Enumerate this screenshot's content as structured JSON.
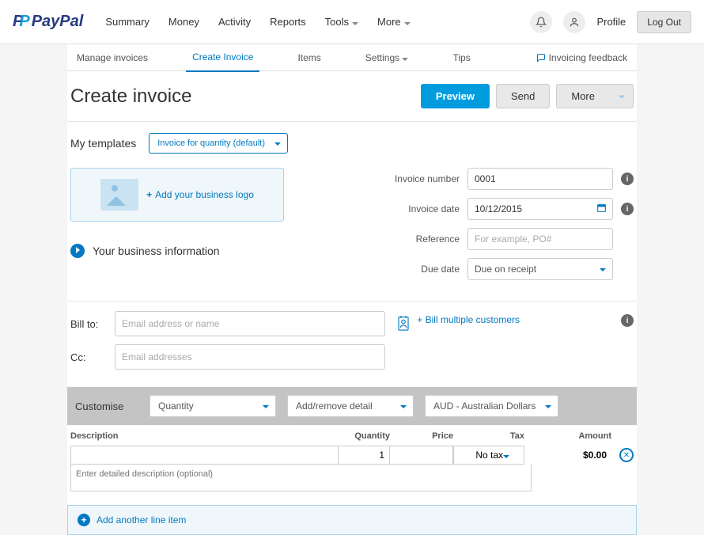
{
  "brand": "PayPal",
  "topnav": {
    "summary": "Summary",
    "money": "Money",
    "activity": "Activity",
    "reports": "Reports",
    "tools": "Tools",
    "more": "More"
  },
  "topactions": {
    "profile": "Profile",
    "logout": "Log Out"
  },
  "subnav": {
    "manage": "Manage invoices",
    "create": "Create Invoice",
    "items": "Items",
    "settings": "Settings",
    "tips": "Tips",
    "feedback": "Invoicing feedback"
  },
  "page": {
    "title": "Create invoice"
  },
  "buttons": {
    "preview": "Preview",
    "send": "Send",
    "more": "More"
  },
  "templates": {
    "label": "My templates",
    "selected": "Invoice for quantity (default)"
  },
  "logo_box": {
    "add_logo": "Add your business logo"
  },
  "biz_info": "Your business information",
  "meta": {
    "invoice_number_label": "Invoice number",
    "invoice_number": "0001",
    "invoice_date_label": "Invoice date",
    "invoice_date": "10/12/2015",
    "reference_label": "Reference",
    "reference_placeholder": "For example, PO#",
    "due_date_label": "Due date",
    "due_date": "Due on receipt"
  },
  "billto": {
    "label": "Bill to:",
    "placeholder": "Email address or name",
    "cc_label": "Cc:",
    "cc_placeholder": "Email addresses",
    "multi": "+ Bill multiple customers"
  },
  "customise": {
    "label": "Customise",
    "quantity": "Quantity",
    "detail": "Add/remove detail",
    "currency": "AUD - Australian Dollars"
  },
  "table": {
    "headers": {
      "desc": "Description",
      "qty": "Quantity",
      "price": "Price",
      "tax": "Tax",
      "amount": "Amount"
    },
    "row": {
      "qty": "1",
      "tax": "No tax",
      "amount": "$0.00"
    },
    "detail_placeholder": "Enter detailed description (optional)"
  },
  "add_line": "Add another line item"
}
